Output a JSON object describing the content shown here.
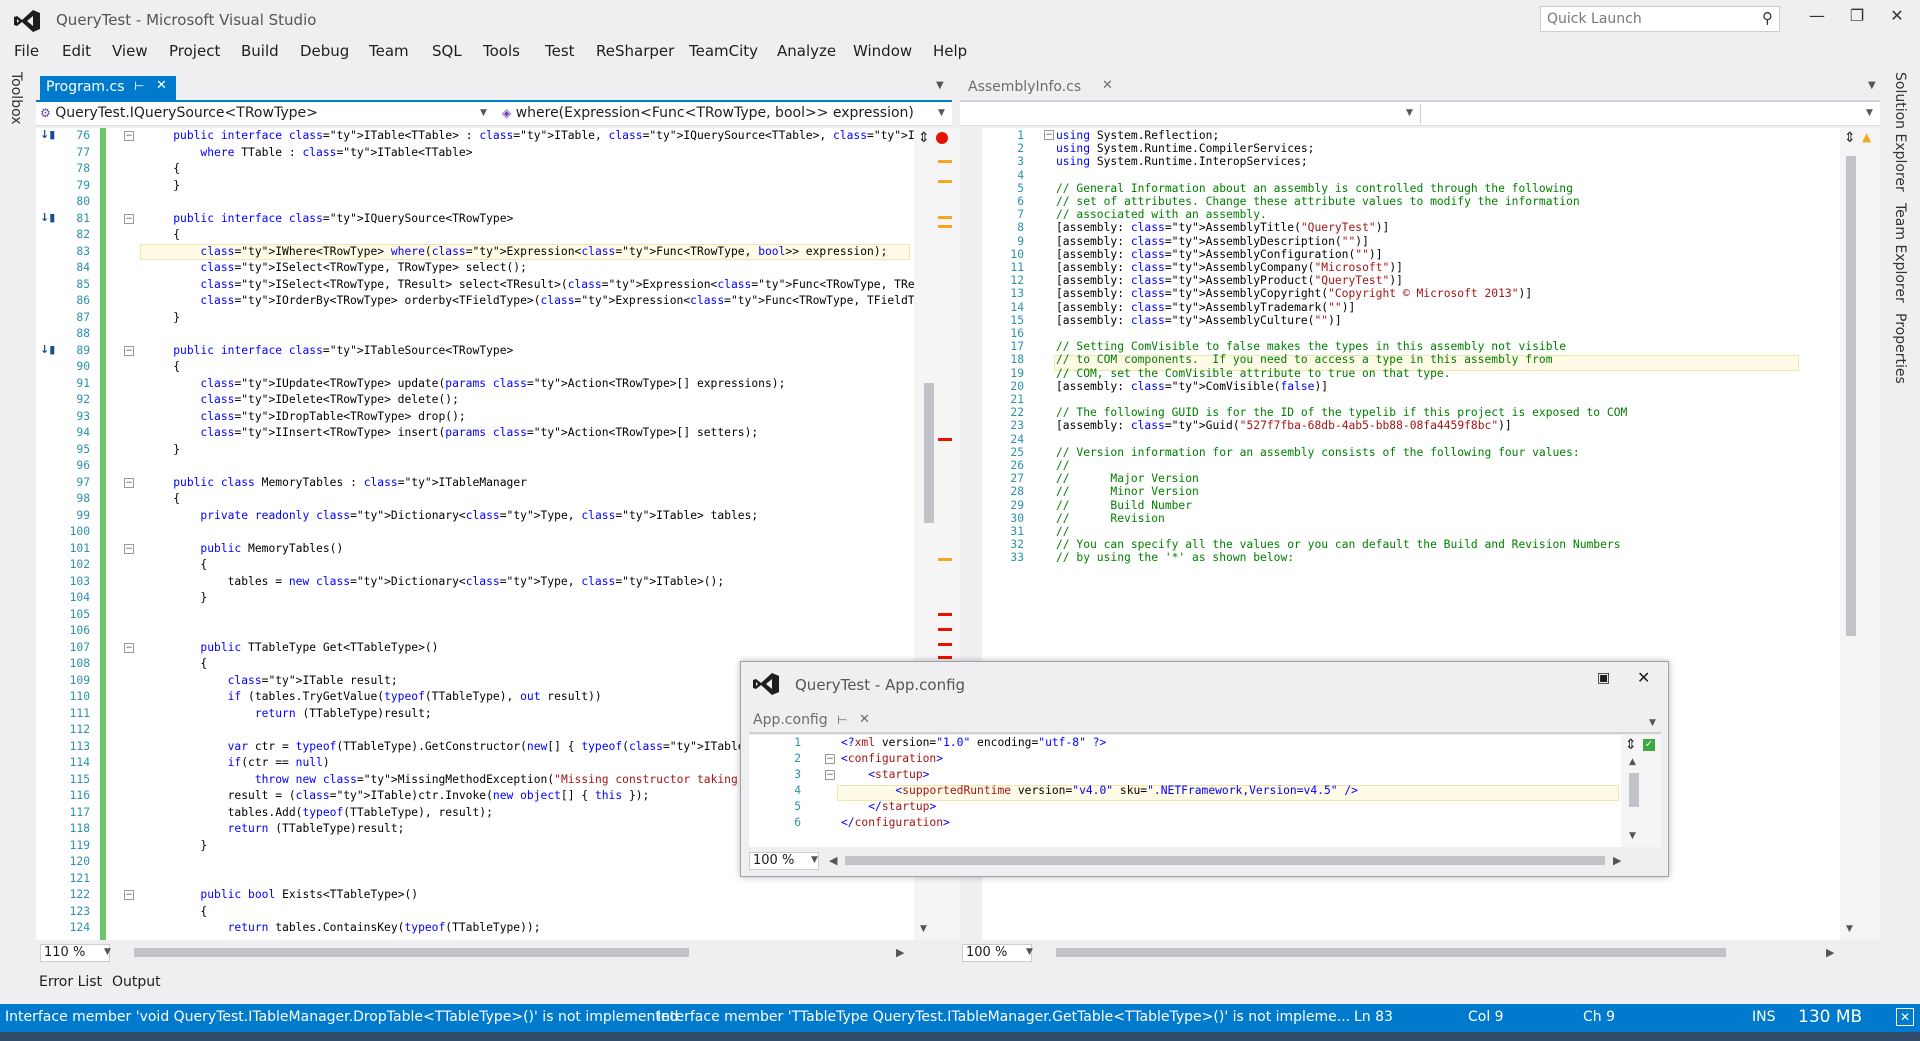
{
  "window": {
    "title": "QueryTest - Microsoft Visual Studio",
    "quick_launch": "Quick Launch"
  },
  "menu": [
    "File",
    "Edit",
    "View",
    "Project",
    "Build",
    "Debug",
    "Team",
    "SQL",
    "Tools",
    "Test",
    "ReSharper",
    "TeamCity",
    "Analyze",
    "Window",
    "Help"
  ],
  "left_side_tabs": [
    "Toolbox"
  ],
  "right_side_tabs": [
    "Solution Explorer",
    "Team Explorer",
    "Properties"
  ],
  "left_pane": {
    "tab": "Program.cs",
    "nav_left": "QueryTest.IQuerySource<TRowType>",
    "nav_right": "where(Expression<Func<TRowType, bool>> expression)",
    "zoom": "110 %",
    "line_numbers": [
      "76",
      "77",
      "78",
      "79",
      "80",
      "81",
      "82",
      "83",
      "84",
      "85",
      "86",
      "87",
      "88",
      "89",
      "90",
      "91",
      "92",
      "93",
      "94",
      "95",
      "96",
      "97",
      "98",
      "99",
      "100",
      "101",
      "102",
      "103",
      "104",
      "105",
      "106",
      "107",
      "108",
      "109",
      "110",
      "111",
      "112",
      "113",
      "114",
      "115",
      "116",
      "117",
      "118",
      "119",
      "120",
      "121",
      "122",
      "123",
      "124"
    ],
    "lines": [
      "    public interface ITable<TTable> : ITable, IQuerySource<TTable>, ITableSource<TTable>",
      "        where TTable : ITable<TTable>",
      "    {",
      "    }",
      "",
      "    public interface IQuerySource<TRowType>",
      "    {",
      "        IWhere<TRowType> where(Expression<Func<TRowType, bool>> expression);",
      "        ISelect<TRowType, TRowType> select();",
      "        ISelect<TRowType, TResult> select<TResult>(Expression<Func<TRowType, TResult>> expression);",
      "        IOrderBy<TRowType> orderby<TFieldType>(Expression<Func<TRowType, TFieldType>> expression);",
      "    }",
      "",
      "    public interface ITableSource<TRowType>",
      "    {",
      "        IUpdate<TRowType> update(params Action<TRowType>[] expressions);",
      "        IDelete<TRowType> delete();",
      "        IDropTable<TRowType> drop();",
      "        IInsert<TRowType> insert(params Action<TRowType>[] setters);",
      "    }",
      "",
      "    public class MemoryTables : ITableManager",
      "    {",
      "        private readonly Dictionary<Type, ITable> tables;",
      "",
      "        public MemoryTables()",
      "        {",
      "            tables = new Dictionary<Type, ITable>();",
      "        }",
      "",
      "",
      "        public TTableType Get<TTableType>()",
      "        {",
      "            ITable result;",
      "            if (tables.TryGetValue(typeof(TTableType), out result))",
      "                return (TTableType)result;",
      "",
      "            var ctr = typeof(TTableType).GetConstructor(new[] { typeof(ITableManager) });",
      "            if(ctr == null)",
      "                throw new MissingMethodException(\"Missing constructor taking ITableManager\");",
      "            result = (ITable)ctr.Invoke(new object[] { this });",
      "            tables.Add(typeof(TTableType), result);",
      "            return (TTableType)result;",
      "        }",
      "",
      "",
      "        public bool Exists<TTableType>()",
      "        {",
      "            return tables.ContainsKey(typeof(TTableType));"
    ]
  },
  "right_pane": {
    "tab": "AssemblyInfo.cs",
    "zoom": "100 %",
    "line_numbers": [
      "1",
      "2",
      "3",
      "4",
      "5",
      "6",
      "7",
      "8",
      "9",
      "10",
      "11",
      "12",
      "13",
      "14",
      "15",
      "16",
      "17",
      "18",
      "19",
      "20",
      "21",
      "22",
      "23",
      "24",
      "25",
      "26",
      "27",
      "28",
      "29",
      "30",
      "31",
      "32",
      "33"
    ],
    "lines": [
      "using System.Reflection;",
      "using System.Runtime.CompilerServices;",
      "using System.Runtime.InteropServices;",
      "",
      "// General Information about an assembly is controlled through the following",
      "// set of attributes. Change these attribute values to modify the information",
      "// associated with an assembly.",
      "[assembly: AssemblyTitle(\"QueryTest\")]",
      "[assembly: AssemblyDescription(\"\")]",
      "[assembly: AssemblyConfiguration(\"\")]",
      "[assembly: AssemblyCompany(\"Microsoft\")]",
      "[assembly: AssemblyProduct(\"QueryTest\")]",
      "[assembly: AssemblyCopyright(\"Copyright © Microsoft 2013\")]",
      "[assembly: AssemblyTrademark(\"\")]",
      "[assembly: AssemblyCulture(\"\")]",
      "",
      "// Setting ComVisible to false makes the types in this assembly not visible",
      "// to COM components.  If you need to access a type in this assembly from",
      "// COM, set the ComVisible attribute to true on that type.",
      "[assembly: ComVisible(false)]",
      "",
      "// The following GUID is for the ID of the typelib if this project is exposed to COM",
      "[assembly: Guid(\"527f7fba-68db-4ab5-bb88-08fa4459f8bc\")]",
      "",
      "// Version information for an assembly consists of the following four values:",
      "//",
      "//      Major Version",
      "//      Minor Version",
      "//      Build Number",
      "//      Revision",
      "//",
      "// You can specify all the values or you can default the Build and Revision Numbers",
      "// by using the '*' as shown below:"
    ]
  },
  "float_window": {
    "title": "QueryTest - App.config",
    "tab": "App.config",
    "zoom": "100 %",
    "line_numbers": [
      "1",
      "2",
      "3",
      "4",
      "5",
      "6"
    ],
    "lines": [
      "<?xml version=\"1.0\" encoding=\"utf-8\" ?>",
      "<configuration>",
      "    <startup>",
      "        <supportedRuntime version=\"v4.0\" sku=\".NETFramework,Version=v4.5\" />",
      "    </startup>",
      "</configuration>"
    ]
  },
  "bottom_tabs": [
    "Error List",
    "Output"
  ],
  "status": {
    "message1": "Interface member 'void QueryTest.ITableManager.DropTable<TTableType>()' is not implemented",
    "message2": "Interface member 'TTableType QueryTest.ITableManager.GetTable<TTableType>()' is not impleme...",
    "ln": "Ln 83",
    "col": "Col 9",
    "ch": "Ch 9",
    "ins": "INS",
    "memory": "130 MB"
  },
  "colors": {
    "accent": "#007acc",
    "keyword": "#0000ff",
    "type": "#2b91af",
    "string": "#a31515",
    "comment": "#008000"
  }
}
